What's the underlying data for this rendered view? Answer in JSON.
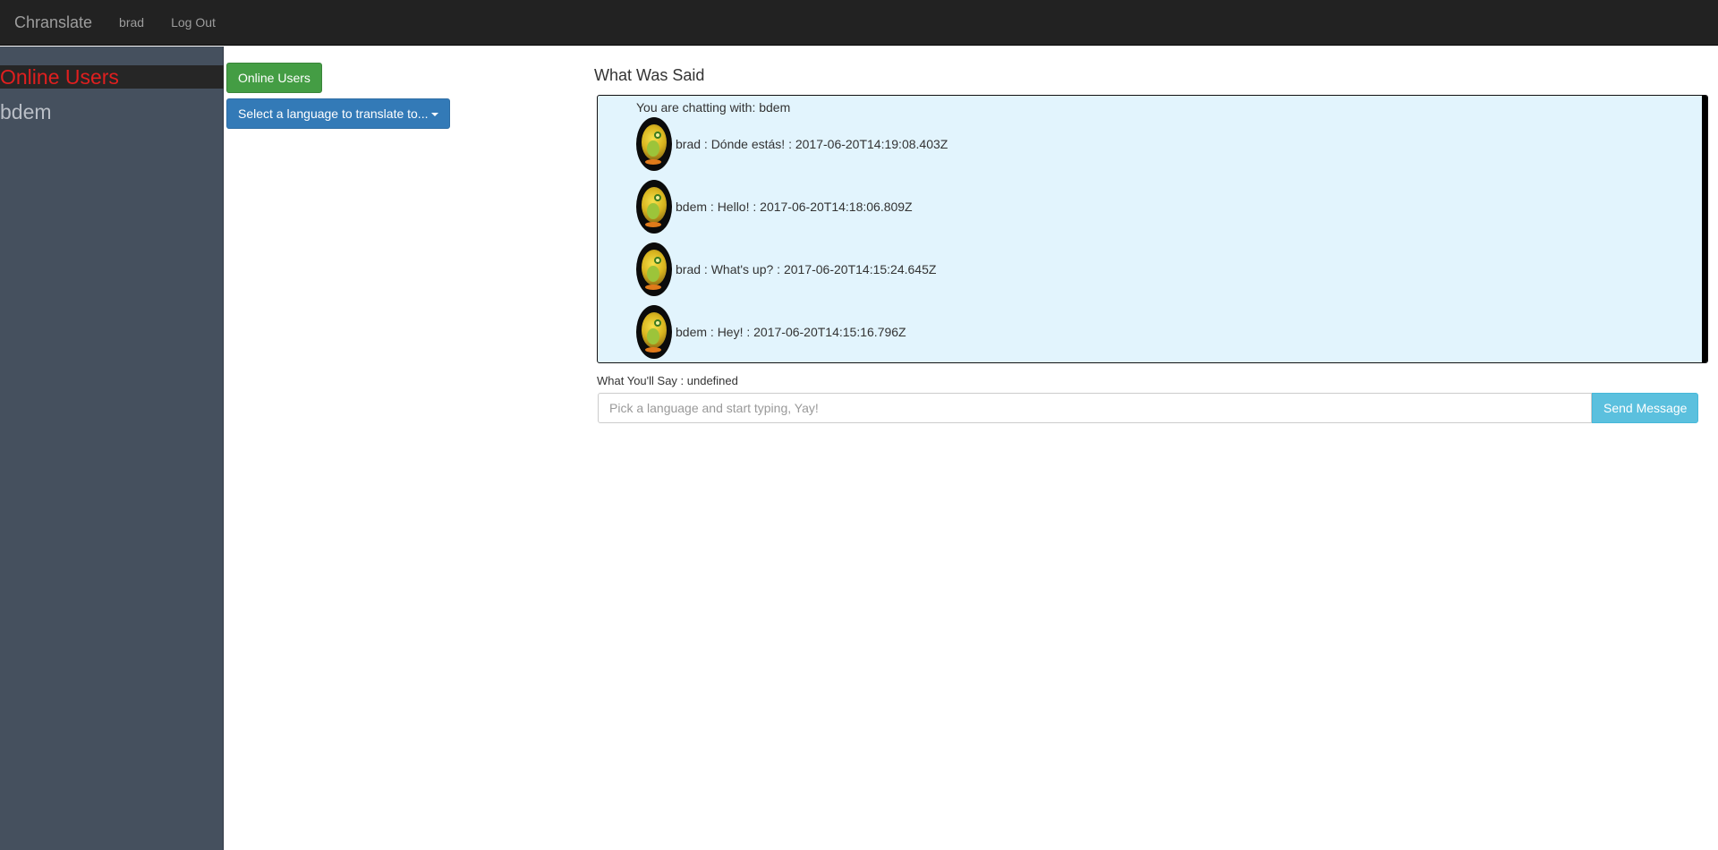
{
  "navbar": {
    "brand": "Chranslate",
    "user": "brad",
    "logout": "Log Out"
  },
  "sidebar": {
    "title": "Online Users",
    "users": [
      "bdem"
    ]
  },
  "controls": {
    "online_users_button": "Online Users",
    "language_button": "Select a language to translate to..."
  },
  "chat": {
    "title": "What Was Said",
    "header": "You are chatting with: bdem",
    "messages": [
      {
        "text": "brad : Dónde estás! : 2017-06-20T14:19:08.403Z"
      },
      {
        "text": "bdem : Hello! : 2017-06-20T14:18:06.809Z"
      },
      {
        "text": "brad : What's up? : 2017-06-20T14:15:24.645Z"
      },
      {
        "text": "bdem : Hey! : 2017-06-20T14:15:16.796Z"
      }
    ]
  },
  "composer": {
    "label": "What You'll Say : undefined",
    "placeholder": "Pick a language and start typing, Yay!",
    "send_label": "Send Message"
  },
  "colors": {
    "navbar": "#222222",
    "sidebar": "#45505e",
    "sidebar_title": "#e01f1f",
    "chat_bg": "#e2f4fd",
    "success_button": "#449d44",
    "primary_button": "#337ab7",
    "info_button": "#5bc0de"
  }
}
